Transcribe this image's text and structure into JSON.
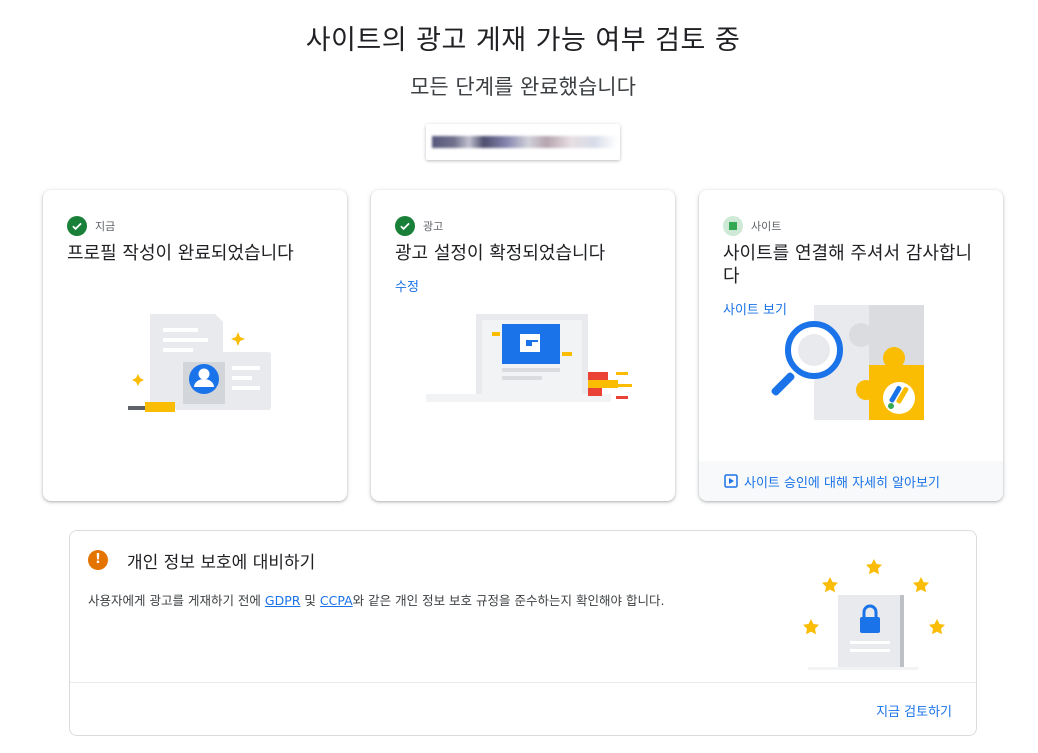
{
  "page": {
    "title": "사이트의 광고 게재 가능 여부 검토 중",
    "subtitle": "모든 단계를 완료했습니다",
    "site_url": ""
  },
  "cards": [
    {
      "status": "지금",
      "title": "프로필 작성이 완료되었습니다",
      "state": "done",
      "illustration": "profile-card-illustration"
    },
    {
      "status": "광고",
      "title": "광고 설정이 확정되었습니다",
      "link": "수정",
      "state": "done",
      "illustration": "ad-browser-illustration"
    },
    {
      "status": "사이트",
      "title": "사이트를 연결해 주셔서 감사합니다",
      "link": "사이트 보기",
      "footer_link": "사이트 승인에 대해 자세히 알아보기",
      "state": "in-progress",
      "illustration": "puzzle-search-illustration"
    }
  ],
  "privacy": {
    "title": "개인 정보 보호에 대비하기",
    "desc_before": "사용자에게 광고를 게재하기 전에 ",
    "gdpr": "GDPR",
    "desc_middle": " 및 ",
    "ccpa": "CCPA",
    "desc_after": "와 같은 개인 정보 보호 규정을 준수하는지 확인해야 합니다.",
    "review_button": "지금 검토하기",
    "warn_glyph": "!"
  },
  "colors": {
    "check": "#188038",
    "link": "#1a73e8",
    "warning": "#e37400"
  }
}
